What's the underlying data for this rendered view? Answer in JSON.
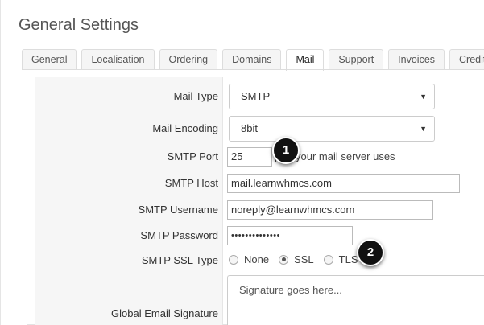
{
  "page": {
    "title": "General Settings"
  },
  "tabs": [
    {
      "label": "General"
    },
    {
      "label": "Localisation"
    },
    {
      "label": "Ordering"
    },
    {
      "label": "Domains"
    },
    {
      "label": "Mail"
    },
    {
      "label": "Support"
    },
    {
      "label": "Invoices"
    },
    {
      "label": "Credit"
    }
  ],
  "form": {
    "mail_type": {
      "label": "Mail Type",
      "value": "SMTP"
    },
    "mail_encoding": {
      "label": "Mail Encoding",
      "value": "8bit"
    },
    "smtp_port": {
      "label": "SMTP Port",
      "value": "25",
      "help": "port your mail server uses"
    },
    "smtp_host": {
      "label": "SMTP Host",
      "value": "mail.learnwhmcs.com"
    },
    "smtp_username": {
      "label": "SMTP Username",
      "value": "noreply@learnwhmcs.com"
    },
    "smtp_password": {
      "label": "SMTP Password",
      "value": "••••••••••••••"
    },
    "smtp_ssl_type": {
      "label": "SMTP SSL Type",
      "options": [
        "None",
        "SSL",
        "TLS"
      ],
      "selected": "SSL"
    },
    "global_email_signature": {
      "label": "Global Email Signature",
      "placeholder": "Signature goes here..."
    }
  },
  "callouts": [
    {
      "number": "1"
    },
    {
      "number": "2"
    }
  ],
  "icons": {
    "select_caret": "▼"
  }
}
